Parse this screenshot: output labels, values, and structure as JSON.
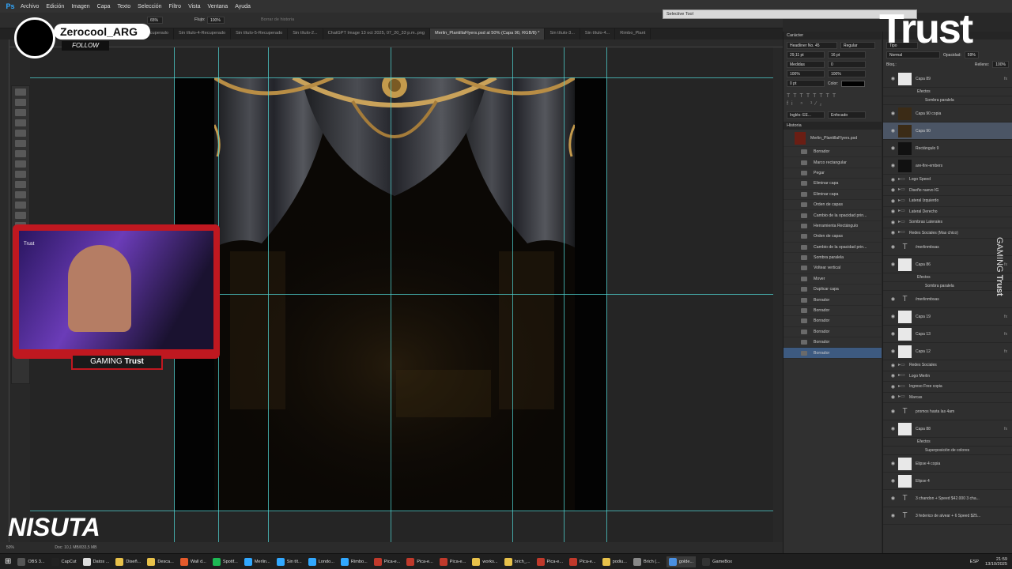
{
  "menu": [
    "Archivo",
    "Edición",
    "Imagen",
    "Capa",
    "Texto",
    "Selección",
    "Filtro",
    "Vista",
    "Ventana",
    "Ayuda"
  ],
  "options": {
    "pct1": "65%",
    "flujo_label": "Flujo:",
    "flujo_value": "100%",
    "history_erase": "Borrar de historia"
  },
  "tabs": [
    "...-Recuperado",
    "Sin título-4-Recuperado",
    "Sin título-5-Recuperado",
    "Sin título-2...",
    "ChatGPT Image 13 oct 2025, 07_20_33 p.m..png",
    "Merlin_PlantillaFlyers.psd al 50% (Capa 90, RGB/8) *",
    "Sin título-3...",
    "Sin título-4...",
    "Rimbo_Plant"
  ],
  "status": {
    "zoom": "50%",
    "doc": "Doc: 10,1 MB/833,5 MB"
  },
  "selective_tool": "Selective Tool",
  "caracter": {
    "title": "Carácter",
    "font": "Headliner No. 45",
    "style": "Regular",
    "size": "29,11 pt",
    "leading": "16 pt",
    "kerning": "Medidas",
    "tracking": "0",
    "vscale": "100%",
    "hscale": "100%",
    "baseline": "0 pt",
    "color_label": "Color:",
    "lang": "Inglés: EE...",
    "aa": "Enfocado"
  },
  "history": {
    "title": "Historia",
    "doc": "Merlin_PlantillaFlyers.psd",
    "items": [
      "Borrador",
      "Marco rectangular",
      "Pegar",
      "Eliminar capa",
      "Eliminar capa",
      "Orden de capas",
      "Cambio de la opacidad prin...",
      "Herramienta Rectángulo",
      "Orden de capas",
      "Cambio de la opacidad prin...",
      "Sombra paralela",
      "Voltear vertical",
      "Mover",
      "Duplicar capa",
      "Borrador",
      "Borrador",
      "Borrador",
      "Borrador",
      "Borrador",
      "Borrador"
    ]
  },
  "layers": {
    "kind": "Tipo",
    "blend": "Normal",
    "opacity_label": "Opacidad:",
    "opacity": "59%",
    "lock_label": "Bloq.:",
    "fill_label": "Relleno:",
    "fill": "100%",
    "rows": [
      {
        "name": "Capa 89",
        "kind": "img",
        "fx": true
      },
      {
        "name": "Efectos",
        "kind": "sub"
      },
      {
        "name": "Sombra paralela",
        "kind": "sub2"
      },
      {
        "name": "Capa 90 copia",
        "kind": "photo"
      },
      {
        "name": "Capa 90",
        "kind": "photo",
        "sel": true
      },
      {
        "name": "Rectángulo 9",
        "kind": "dark"
      },
      {
        "name": "are-fire-embers",
        "kind": "dark"
      },
      {
        "name": "Logo Speed",
        "kind": "folder"
      },
      {
        "name": "Diseño nuevo IG",
        "kind": "folder"
      },
      {
        "name": "Lateral Izquierdo",
        "kind": "folder"
      },
      {
        "name": "Lateral Derecho",
        "kind": "folder"
      },
      {
        "name": "Sombras Laterales",
        "kind": "folder"
      },
      {
        "name": "Redes Sociales (Mas chico)",
        "kind": "folder"
      },
      {
        "name": "/merlinmbsas",
        "kind": "text"
      },
      {
        "name": "Capa 86",
        "kind": "img",
        "fx": true
      },
      {
        "name": "Efectos",
        "kind": "sub"
      },
      {
        "name": "Sombra paralela",
        "kind": "sub2"
      },
      {
        "name": "/merlinmbsas",
        "kind": "text"
      },
      {
        "name": "Capa 19",
        "kind": "img",
        "fx": true
      },
      {
        "name": "Capa 13",
        "kind": "img",
        "fx": true
      },
      {
        "name": "Capa 12",
        "kind": "img",
        "fx": true
      },
      {
        "name": "Redes Sociales",
        "kind": "folder"
      },
      {
        "name": "Logo Merlin",
        "kind": "folder"
      },
      {
        "name": "Ingreso Free copia",
        "kind": "folder"
      },
      {
        "name": "Marcas",
        "kind": "folder"
      },
      {
        "name": "promos hasta las 4am",
        "kind": "text"
      },
      {
        "name": "Capa 88",
        "kind": "img",
        "fx": true
      },
      {
        "name": "Efectos",
        "kind": "sub"
      },
      {
        "name": "Superposición de colores",
        "kind": "sub2"
      },
      {
        "name": "Elipse 4 copia",
        "kind": "img"
      },
      {
        "name": "Elipse 4",
        "kind": "img"
      },
      {
        "name": "3 chandon + Speed $42.000   3 cha...",
        "kind": "text"
      },
      {
        "name": "3 federico de alvear + 6 Speed $25...",
        "kind": "text"
      }
    ]
  },
  "overlay": {
    "tiktok_user": "Zerocool_ARG",
    "follow": "FOLLOW",
    "gaming": "GAMING",
    "trust": "Trust",
    "nisuta": "NISUTA",
    "badge": "Trust",
    "side": "GAMING"
  },
  "taskbar": {
    "items": [
      "OBS 3...",
      "CapCut",
      "Datos ...",
      "Diseñ...",
      "Desca...",
      "Wall d...",
      "Spotif...",
      "Merlin...",
      "Sin tít...",
      "Londo...",
      "Rimbo...",
      "Pica-e...",
      "Pica-e...",
      "Pica-e...",
      "works...",
      "brich_...",
      "Pica-e...",
      "Pica-e...",
      "podiu...",
      "Brich (...",
      "golde...",
      "GameBox"
    ],
    "colors": [
      "#555",
      "#222",
      "#ddd",
      "#e8c14a",
      "#e8c14a",
      "#e55a2b",
      "#1db954",
      "#31a8ff",
      "#31a8ff",
      "#31a8ff",
      "#31a8ff",
      "#c0392b",
      "#c0392b",
      "#c0392b",
      "#e8c14a",
      "#e8c14a",
      "#c0392b",
      "#c0392b",
      "#e8c14a",
      "#888",
      "#4a90e2",
      "#333"
    ],
    "lang": "ESP",
    "time": "21:59",
    "date": "13/10/2025"
  }
}
